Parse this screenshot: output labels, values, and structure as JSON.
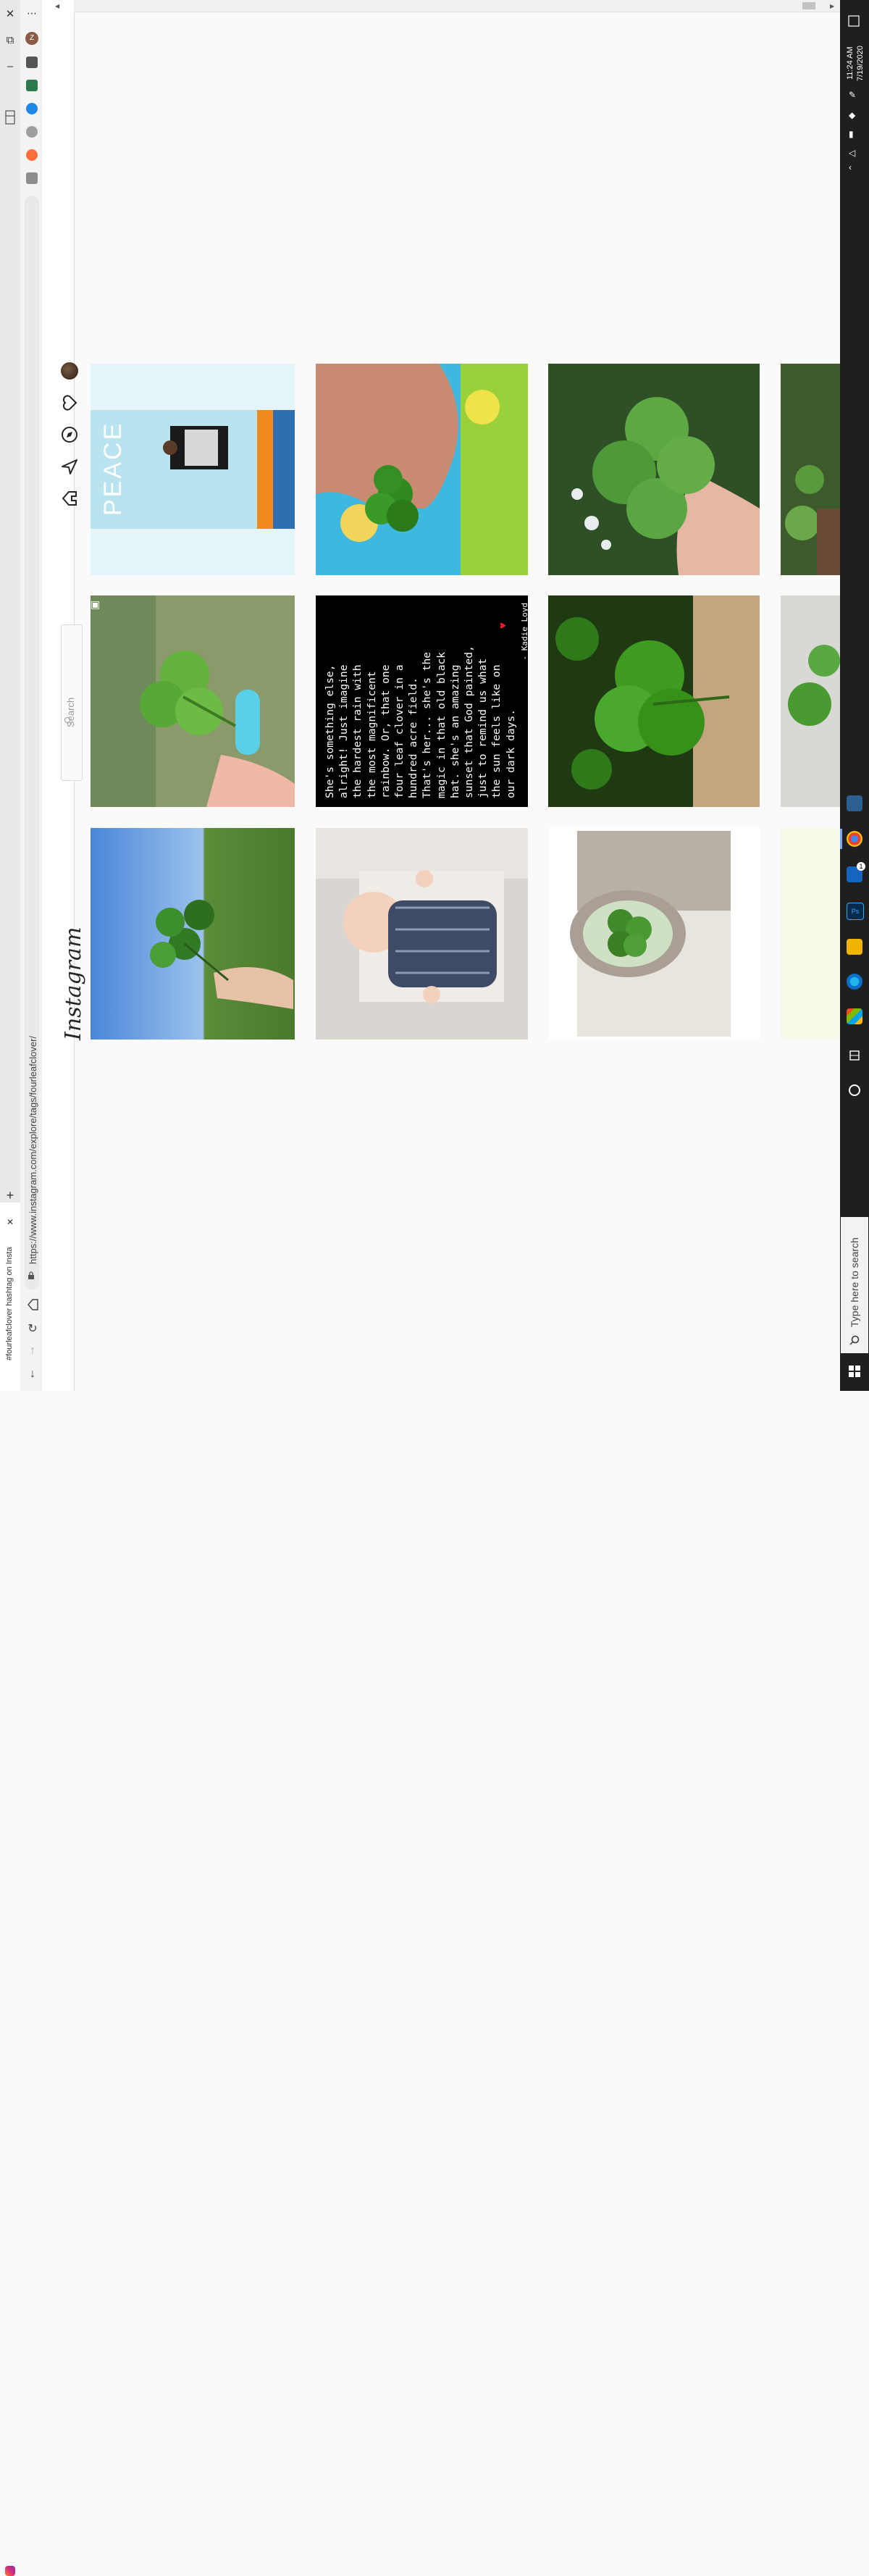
{
  "browser": {
    "tab_title": "#fourleafclover hashtag on Insta",
    "url": "https://www.instagram.com/explore/tags/fourleafclover/",
    "close_tab_glyph": "✕",
    "new_tab_glyph": "+",
    "menu_glyph": "⋯",
    "window_close_glyph": "✕",
    "window_restore_glyph": "⧉",
    "window_minimize_glyph": "–",
    "profile_initial": "Z"
  },
  "instagram": {
    "logo": "Instagram",
    "search_placeholder": "Search"
  },
  "posts": [
    {
      "id": "p1",
      "kind": "photo",
      "description_icon": "hand-clover"
    },
    {
      "id": "p2",
      "kind": "photo"
    },
    {
      "id": "p3",
      "kind": "photo"
    },
    {
      "id": "p4",
      "kind": "photo"
    },
    {
      "id": "p5",
      "kind": "quote",
      "quote_lines": [
        "She's something else,",
        "alright! Just imagine",
        "the hardest rain with",
        "the most magnificent",
        "rainbow. Or, that one",
        "four leaf clover in a",
        "hundred acre field.",
        "That's her... she's the",
        "magic in that old black",
        "hat. she's an amazing",
        "sunset that God painted,",
        "just to remind us what",
        "the sun feels like on",
        "our dark days.",
        "- Kadie Loyd"
      ]
    },
    {
      "id": "p6",
      "kind": "photo"
    },
    {
      "id": "p7",
      "kind": "photo"
    },
    {
      "id": "p8",
      "kind": "photo"
    },
    {
      "id": "p9",
      "kind": "photo",
      "overlay_text": "PEACE"
    }
  ],
  "taskbar": {
    "time": "11:24 AM",
    "date": "7/19/2020",
    "search_placeholder": "Type here to search",
    "notification_count": "1"
  },
  "colors": {
    "ig_background": "#fafafa",
    "taskbar": "#1f1f1f",
    "quote_tile": "#000000",
    "clover_green": "#3f8f2c"
  }
}
